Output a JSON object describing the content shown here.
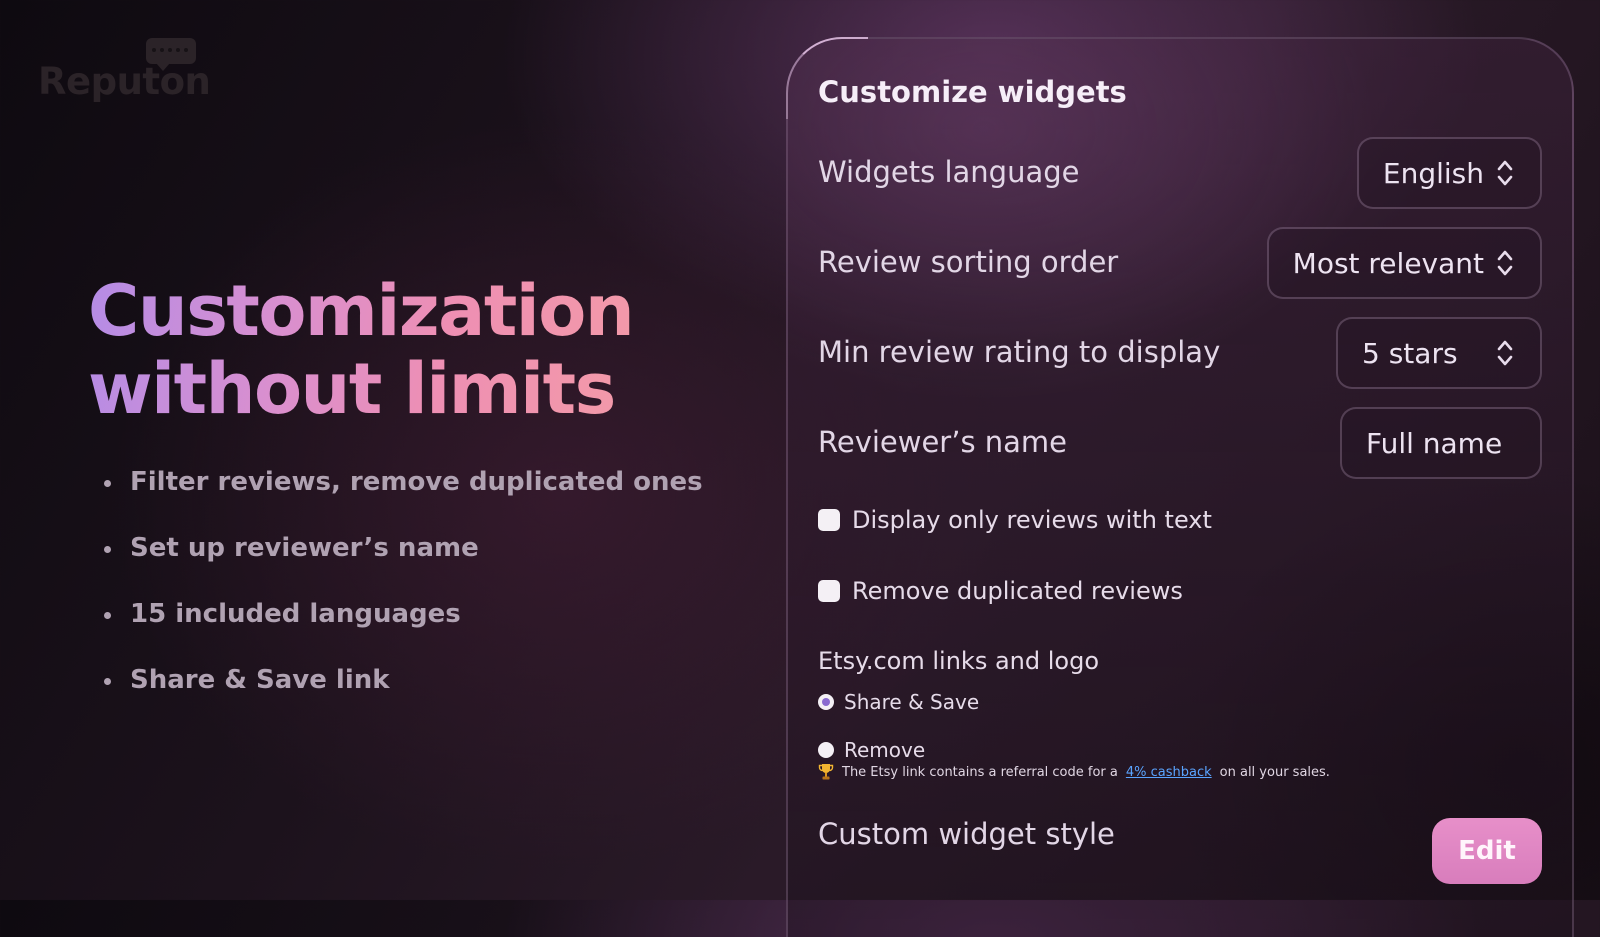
{
  "brand": {
    "logo_text": "Reputon"
  },
  "hero": {
    "title_line1": "Customization",
    "title_line2": "without limits",
    "features": [
      "Filter reviews, remove duplicated ones",
      "Set up reviewer’s name",
      "15 included languages",
      "Share & Save link"
    ]
  },
  "panel": {
    "title": "Customize widgets",
    "settings": [
      {
        "label": "Widgets language",
        "value": "English"
      },
      {
        "label": "Review sorting order",
        "value": "Most relevant"
      },
      {
        "label": "Min review rating to display",
        "value": "5 stars"
      },
      {
        "label": "Reviewer’s name",
        "value": "Full name"
      }
    ],
    "checkboxes": [
      {
        "label": "Display only reviews with text",
        "checked": false
      },
      {
        "label": "Remove duplicated reviews",
        "checked": false
      }
    ],
    "links_section": {
      "label": "Etsy.com links and logo",
      "options": [
        {
          "label": "Share & Save",
          "selected": true
        },
        {
          "label": "Remove",
          "selected": false
        }
      ]
    },
    "note": {
      "prefix": "The Etsy link contains a referral code for a",
      "link": "4% cashback",
      "suffix": "on all your sales."
    },
    "custom_style": {
      "label": "Custom widget style",
      "button": "Edit"
    }
  },
  "colors": {
    "accent_pink": "#e78fc9",
    "radio_selected": "#8a6ad0",
    "link": "#5aa4ff"
  },
  "icons": {
    "select_chevron": "chevron-up-down-icon",
    "note": "trophy-icon"
  }
}
